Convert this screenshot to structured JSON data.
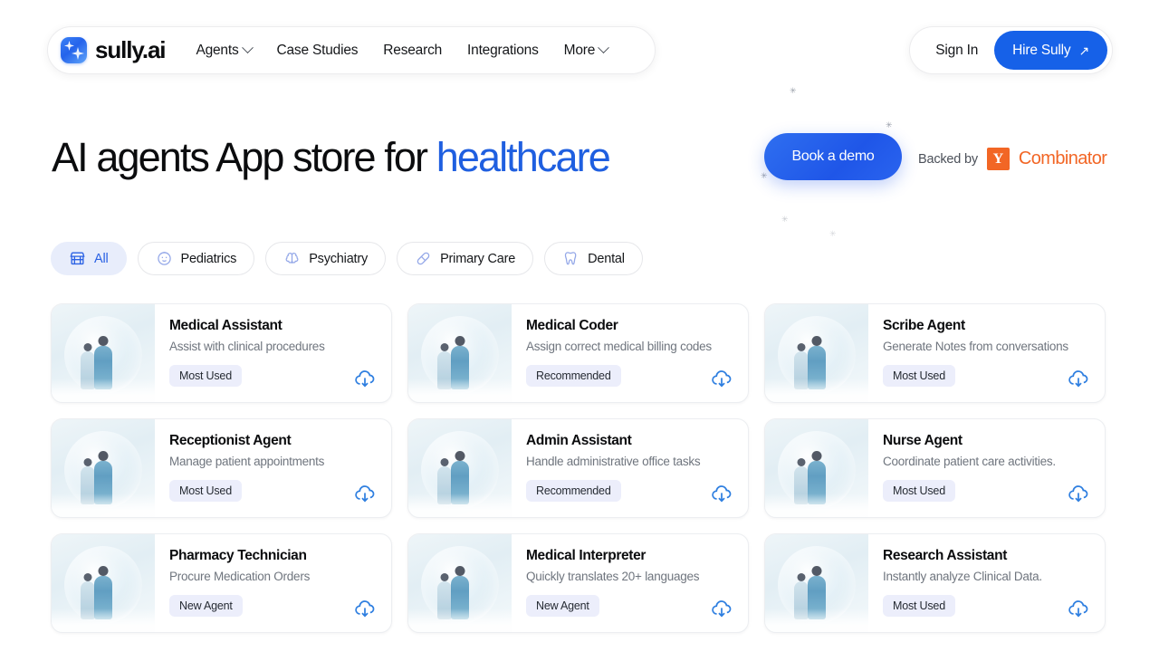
{
  "nav": {
    "brand": "sully.ai",
    "links": [
      {
        "label": "Agents",
        "caret": true
      },
      {
        "label": "Case Studies",
        "caret": false
      },
      {
        "label": "Research",
        "caret": false
      },
      {
        "label": "Integrations",
        "caret": false
      },
      {
        "label": "More",
        "caret": true
      }
    ],
    "sign_in": "Sign In",
    "hire": "Hire Sully",
    "hire_arrow": "↗"
  },
  "hero": {
    "title_lead": "AI agents App store for ",
    "title_accent": "healthcare",
    "demo_button": "Book a demo",
    "backed_label": "Backed by",
    "yc_letter": "Y",
    "yc_word": "Combinator"
  },
  "filters": [
    {
      "label": "All",
      "icon": "storefront-icon",
      "active": true
    },
    {
      "label": "Pediatrics",
      "icon": "baby-face-icon",
      "active": false
    },
    {
      "label": "Psychiatry",
      "icon": "brain-icon",
      "active": false
    },
    {
      "label": "Primary Care",
      "icon": "capsule-pill-icon",
      "active": false
    },
    {
      "label": "Dental",
      "icon": "tooth-icon",
      "active": false
    }
  ],
  "cards": [
    {
      "title": "Medical Assistant",
      "subtitle": "Assist with clinical procedures",
      "badge": "Most Used"
    },
    {
      "title": "Medical Coder",
      "subtitle": "Assign correct medical billing codes",
      "badge": "Recommended"
    },
    {
      "title": "Scribe Agent",
      "subtitle": "Generate Notes from conversations",
      "badge": "Most Used"
    },
    {
      "title": "Receptionist Agent",
      "subtitle": "Manage patient appointments",
      "badge": "Most Used"
    },
    {
      "title": "Admin Assistant",
      "subtitle": "Handle administrative office tasks",
      "badge": "Recommended"
    },
    {
      "title": "Nurse Agent",
      "subtitle": "Coordinate patient care activities.",
      "badge": "Most Used"
    },
    {
      "title": "Pharmacy Technician",
      "subtitle": "Procure Medication Orders",
      "badge": "New Agent"
    },
    {
      "title": "Medical Interpreter",
      "subtitle": "Quickly translates 20+ languages",
      "badge": "New Agent"
    },
    {
      "title": "Research Assistant",
      "subtitle": "Instantly analyze Clinical Data.",
      "badge": "Most Used"
    }
  ],
  "card_download_icon": "cloud-download-icon",
  "colors": {
    "accent_blue": "#1f5fe0",
    "button_blue": "#1661e8",
    "yc_orange": "#f26625",
    "badge_bg": "#eceefb",
    "chip_active_bg": "#e8edfb"
  }
}
